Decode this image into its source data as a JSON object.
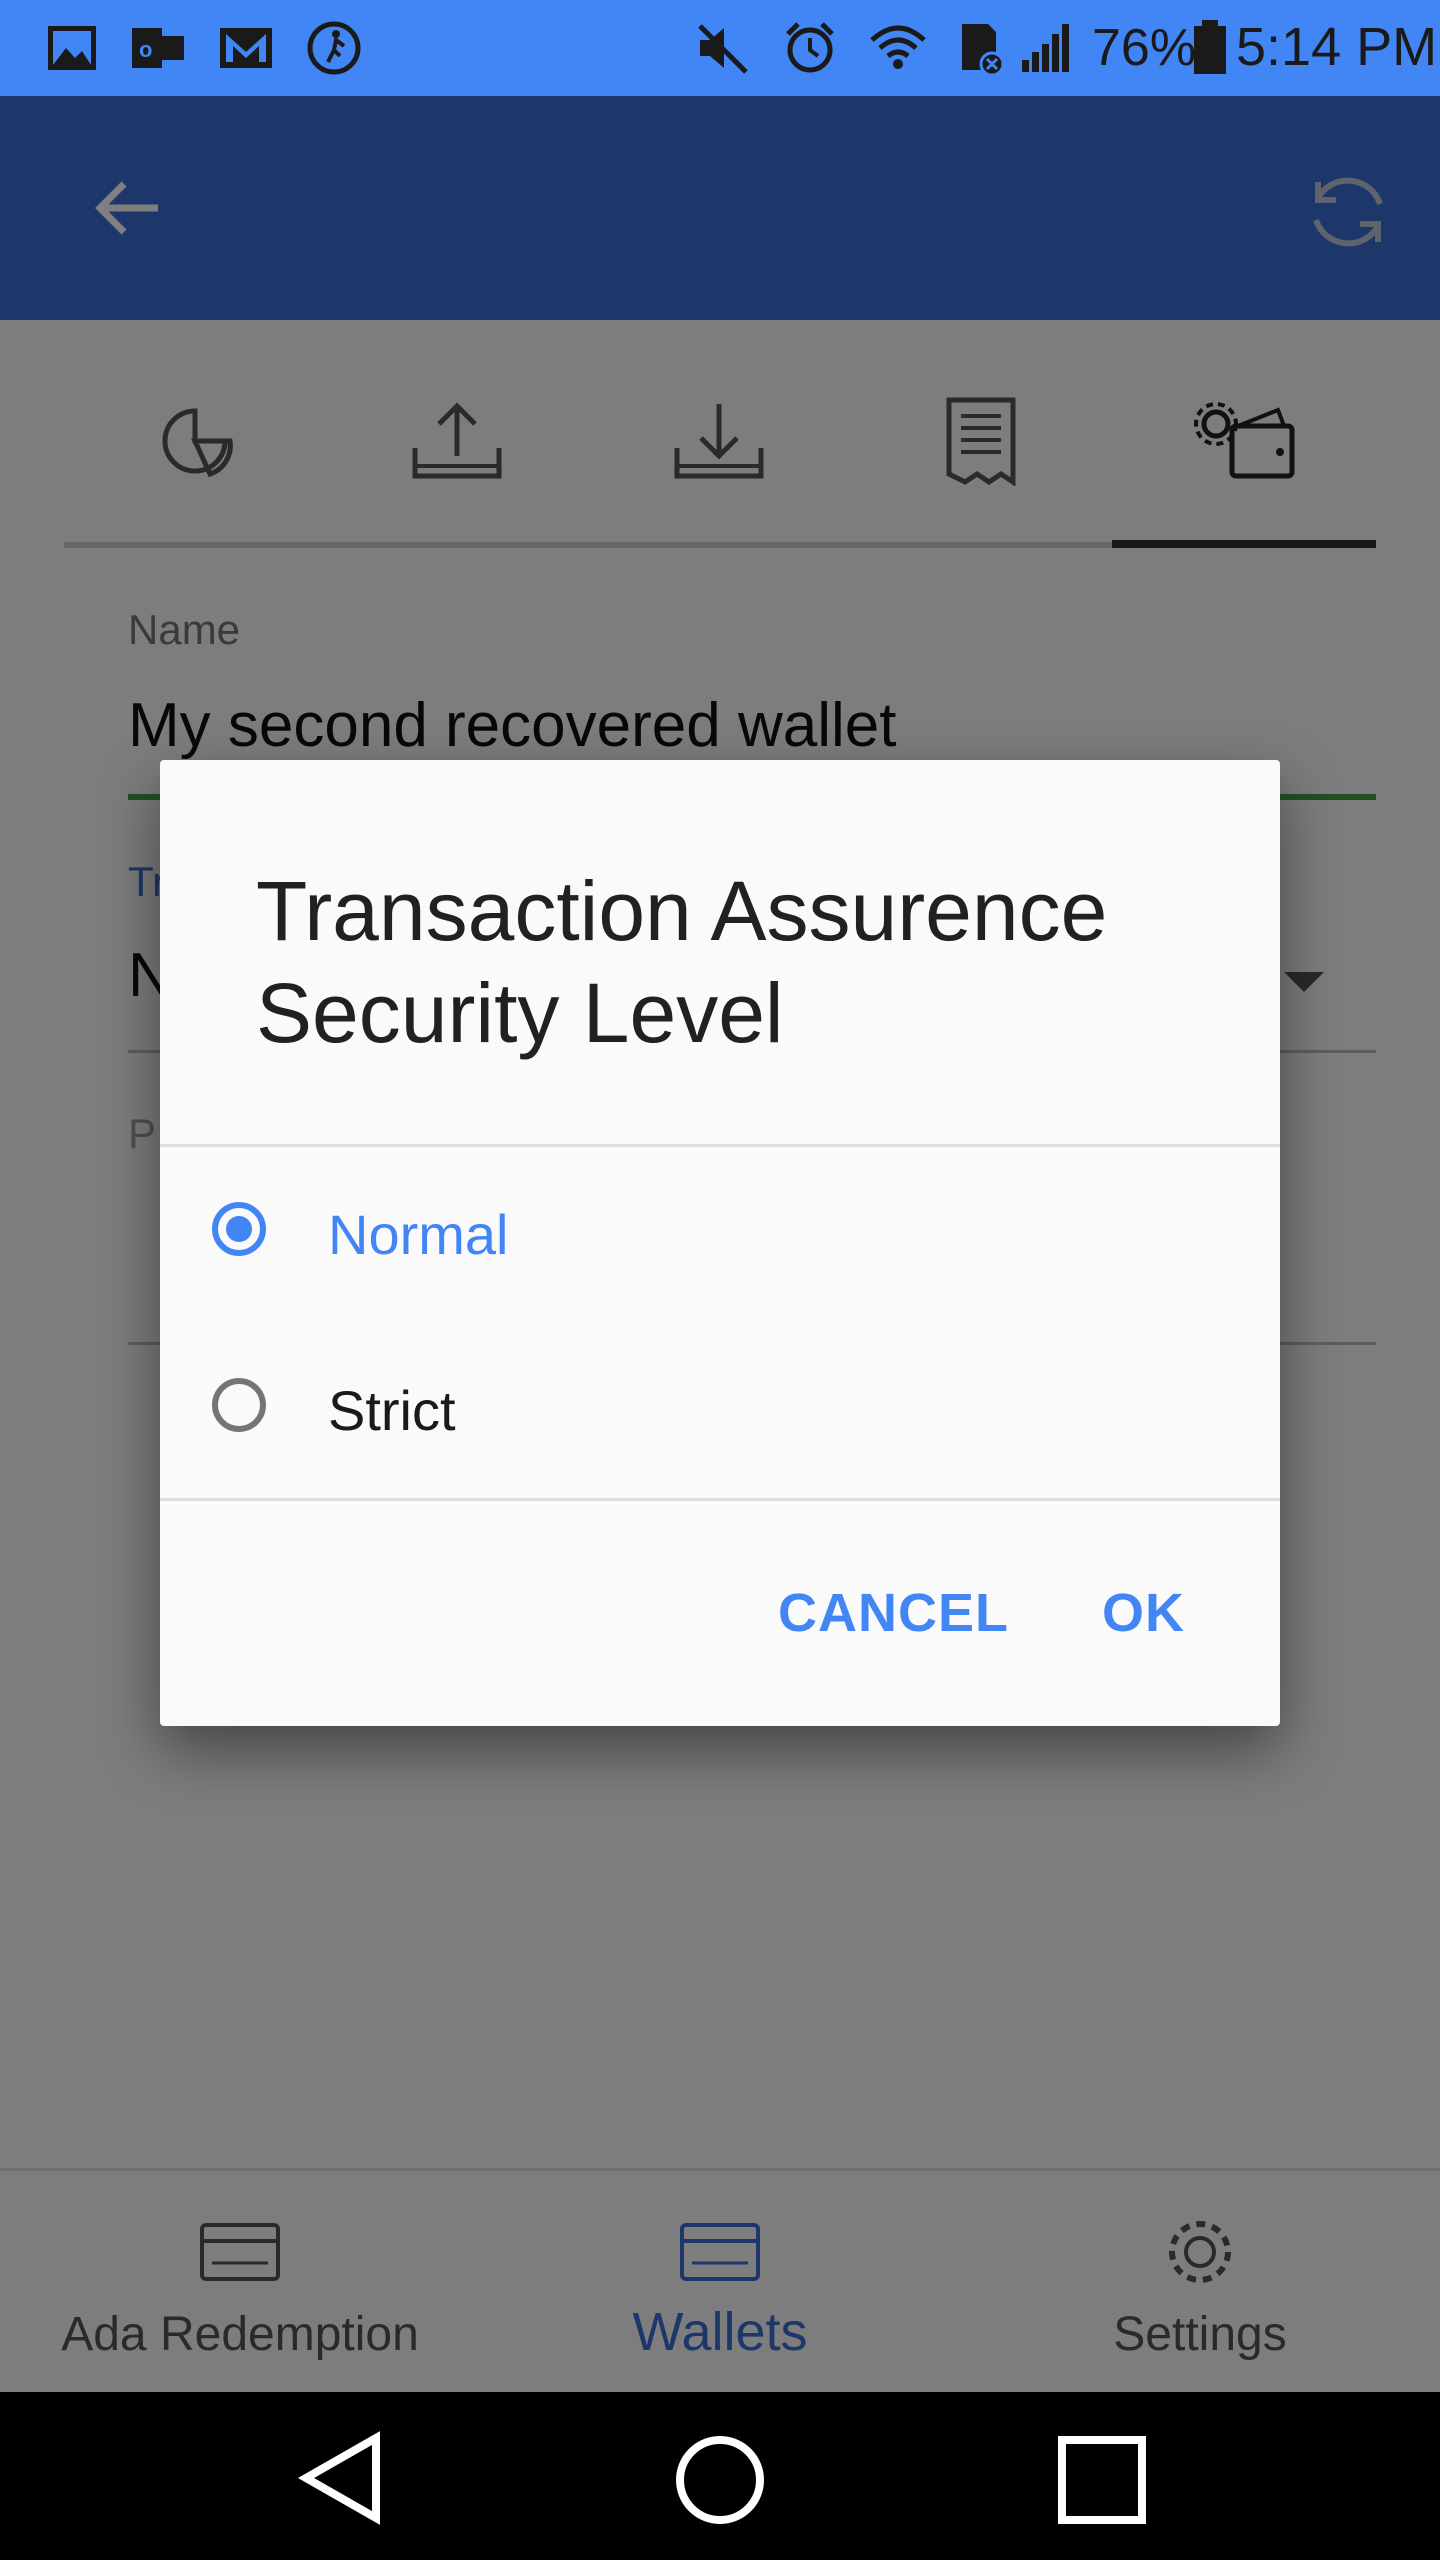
{
  "status_bar": {
    "battery_text": "76%",
    "time": "5:14 PM",
    "icons": [
      "gallery-icon",
      "outlook-icon",
      "gmail-icon",
      "activity-icon",
      "mute-icon",
      "alarm-icon",
      "wifi-icon",
      "sd-card-icon",
      "signal-icon",
      "battery-icon"
    ]
  },
  "app_bar": {
    "back_icon": "arrow-left-icon",
    "sync_icon": "sync-icon"
  },
  "tabs": [
    {
      "icon": "summary-pie-icon"
    },
    {
      "icon": "send-upload-icon"
    },
    {
      "icon": "receive-download-icon"
    },
    {
      "icon": "transactions-receipt-icon"
    },
    {
      "icon": "wallet-settings-icon",
      "active": true
    }
  ],
  "form": {
    "name_label": "Name",
    "name_value": "My second recovered wallet",
    "level_label": "Tr",
    "level_value": "N",
    "password_label": "P"
  },
  "dialog": {
    "title": "Transaction Assurence Security Level",
    "options": [
      {
        "label": "Normal",
        "selected": true
      },
      {
        "label": "Strict",
        "selected": false
      }
    ],
    "cancel_label": "CANCEL",
    "ok_label": "OK"
  },
  "bottom_nav": {
    "items": [
      {
        "label": "Ada Redemption",
        "icon": "card-icon"
      },
      {
        "label": "Wallets",
        "icon": "wallet-card-icon",
        "active": true
      },
      {
        "label": "Settings",
        "icon": "gear-icon"
      }
    ]
  },
  "colors": {
    "status_bar": "#4285f4",
    "app_bar": "#3d6fd6",
    "accent": "#4285f4",
    "underline_active": "#43a047"
  }
}
